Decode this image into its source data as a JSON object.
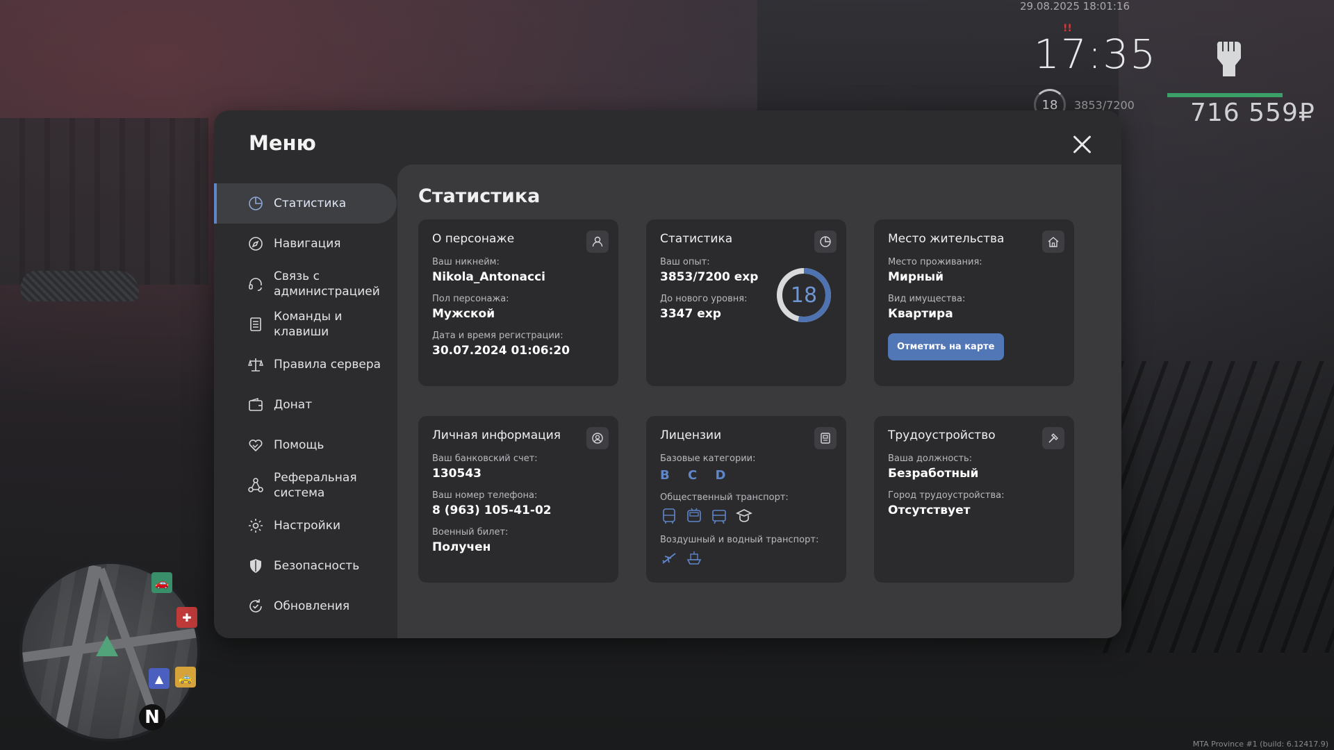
{
  "hud": {
    "date": "29.08.2025 18:01:16",
    "time": "17:35",
    "alert": "!!",
    "level": "18",
    "exp": "3853/7200",
    "money": "716 559₽",
    "build": "MTA Province #1 (build: 6.12417.9)",
    "health_fraction": 1.0
  },
  "minimap": {
    "north": "N"
  },
  "menu": {
    "title": "Меню",
    "sidebar": [
      {
        "label": "Статистика",
        "icon": "pie-chart-icon",
        "active": true
      },
      {
        "label": "Навигация",
        "icon": "compass-icon"
      },
      {
        "label": "Связь с администрацией",
        "icon": "headset-icon"
      },
      {
        "label": "Команды и клавиши",
        "icon": "document-icon"
      },
      {
        "label": "Правила сервера",
        "icon": "scales-icon"
      },
      {
        "label": "Донат",
        "icon": "wallet-icon"
      },
      {
        "label": "Помощь",
        "icon": "handshake-heart-icon"
      },
      {
        "label": "Реферальная система",
        "icon": "network-icon"
      },
      {
        "label": "Настройки",
        "icon": "gear-icon"
      },
      {
        "label": "Безопасность",
        "icon": "shield-icon"
      },
      {
        "label": "Обновления",
        "icon": "refresh-icon"
      }
    ]
  },
  "stats": {
    "title": "Статистика",
    "character": {
      "title": "О персонаже",
      "nick_label": "Ваш никнейм:",
      "nick": "Nikola_Antonacci",
      "gender_label": "Пол персонажа:",
      "gender": "Мужской",
      "reg_label": "Дата и время регистрации:",
      "reg": "30.07.2024 01:06:20"
    },
    "statistics": {
      "title": "Статистика",
      "exp_label": "Ваш опыт:",
      "exp": "3853/7200 exp",
      "next_label": "До нового уровня:",
      "next": "3347 exp",
      "level": "18",
      "progress": 0.535
    },
    "residence": {
      "title": "Место жительства",
      "place_label": "Место проживания:",
      "place": "Мирный",
      "type_label": "Вид имущества:",
      "type": "Квартира",
      "button": "Отметить на карте"
    },
    "personal": {
      "title": "Личная информация",
      "bank_label": "Ваш банковский счет:",
      "bank": "130543",
      "phone_label": "Ваш номер телефона:",
      "phone": "8 (963) 105-41-02",
      "military_label": "Военный билет:",
      "military": "Получен"
    },
    "licenses": {
      "title": "Лицензии",
      "base_label": "Базовые категории:",
      "base": "B C D",
      "public_label": "Общественный транспорт:",
      "air_label": "Воздушный и водный транспорт:"
    },
    "employment": {
      "title": "Трудоустройство",
      "position_label": "Ваша должность:",
      "position": "Безработный",
      "city_label": "Город трудоустройства:",
      "city": "Отсутствует"
    }
  },
  "colors": {
    "accent": "#5f86c9",
    "button": "#5277b6",
    "panel": "#2c2c2e",
    "card": "#2b2b2e",
    "content": "#3a3a3d"
  }
}
